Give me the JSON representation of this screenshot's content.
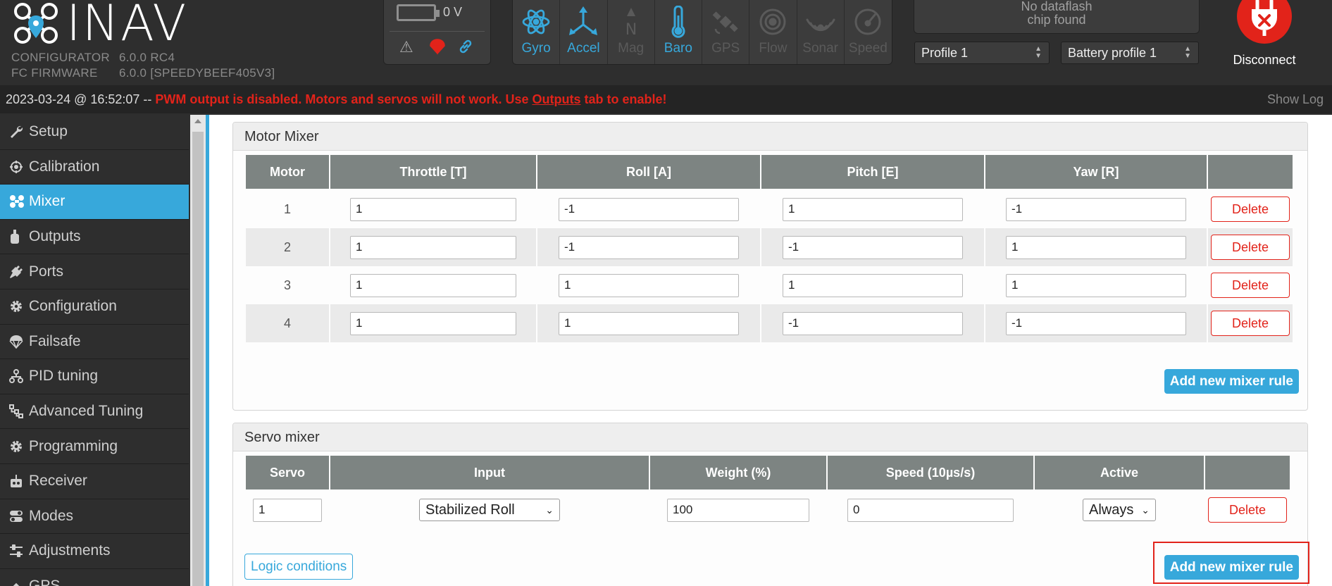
{
  "app": {
    "logo_text": "INAV",
    "configurator_label": "CONFIGURATOR",
    "configurator_version": "6.0.0 RC4",
    "firmware_label": "FC FIRMWARE",
    "firmware_version": "6.0.0 [SPEEDYBEEF405V3]"
  },
  "battery": {
    "voltage": "0 V"
  },
  "sensors": [
    {
      "name": "Gyro",
      "icon": "gyro-icon",
      "active": true
    },
    {
      "name": "Accel",
      "icon": "accel-icon",
      "active": true
    },
    {
      "name": "Mag",
      "icon": "mag-icon",
      "active": false
    },
    {
      "name": "Baro",
      "icon": "baro-icon",
      "active": true
    },
    {
      "name": "GPS",
      "icon": "gps-icon",
      "active": false
    },
    {
      "name": "Flow",
      "icon": "flow-icon",
      "active": false
    },
    {
      "name": "Sonar",
      "icon": "sonar-icon",
      "active": false
    },
    {
      "name": "Speed",
      "icon": "speed-icon",
      "active": false
    }
  ],
  "dataflash": {
    "line1": "No dataflash",
    "line2": "chip found"
  },
  "profiles": {
    "profile": "Profile 1",
    "battery_profile": "Battery profile 1"
  },
  "disconnect_label": "Disconnect",
  "log": {
    "timestamp": "2023-03-24 @ 16:52:07 --",
    "message_before": "PWM output is disabled. Motors and servos will not work. Use",
    "message_link": "Outputs",
    "message_after": "tab to enable!",
    "show_log": "Show Log"
  },
  "sidebar": {
    "items": [
      {
        "label": "Setup",
        "icon": "wrench-icon",
        "active": false
      },
      {
        "label": "Calibration",
        "icon": "crosshair-icon",
        "active": false
      },
      {
        "label": "Mixer",
        "icon": "mixer-icon",
        "active": true
      },
      {
        "label": "Outputs",
        "icon": "motor-icon",
        "active": false
      },
      {
        "label": "Ports",
        "icon": "plug-icon",
        "active": false
      },
      {
        "label": "Configuration",
        "icon": "gear-icon",
        "active": false
      },
      {
        "label": "Failsafe",
        "icon": "parachute-icon",
        "active": false
      },
      {
        "label": "PID tuning",
        "icon": "tuning-icon",
        "active": false
      },
      {
        "label": "Advanced Tuning",
        "icon": "advanced-tuning-icon",
        "active": false
      },
      {
        "label": "Programming",
        "icon": "gear-icon",
        "active": false
      },
      {
        "label": "Receiver",
        "icon": "receiver-icon",
        "active": false
      },
      {
        "label": "Modes",
        "icon": "toggle-icon",
        "active": false
      },
      {
        "label": "Adjustments",
        "icon": "sliders-icon",
        "active": false
      },
      {
        "label": "GPS",
        "icon": "gps-icon",
        "active": false
      }
    ]
  },
  "motor_mixer": {
    "title": "Motor Mixer",
    "headers": [
      "Motor",
      "Throttle [T]",
      "Roll [A]",
      "Pitch [E]",
      "Yaw [R]",
      ""
    ],
    "rows": [
      {
        "motor": "1",
        "throttle": "1",
        "roll": "-1",
        "pitch": "1",
        "yaw": "-1"
      },
      {
        "motor": "2",
        "throttle": "1",
        "roll": "-1",
        "pitch": "-1",
        "yaw": "1"
      },
      {
        "motor": "3",
        "throttle": "1",
        "roll": "1",
        "pitch": "1",
        "yaw": "1"
      },
      {
        "motor": "4",
        "throttle": "1",
        "roll": "1",
        "pitch": "-1",
        "yaw": "-1"
      }
    ],
    "delete_label": "Delete",
    "add_label": "Add new mixer rule"
  },
  "servo_mixer": {
    "title": "Servo mixer",
    "headers": [
      "Servo",
      "Input",
      "Weight (%)",
      "Speed (10µs/s)",
      "Active",
      ""
    ],
    "rows": [
      {
        "servo": "1",
        "input": "Stabilized Roll",
        "weight": "100",
        "speed": "0",
        "active": "Always"
      }
    ],
    "delete_label": "Delete",
    "add_label": "Add new mixer rule",
    "logic_label": "Logic conditions"
  },
  "colors": {
    "accent": "#37a8db",
    "danger": "#e2231a",
    "header_bg": "#2e2e2e"
  }
}
